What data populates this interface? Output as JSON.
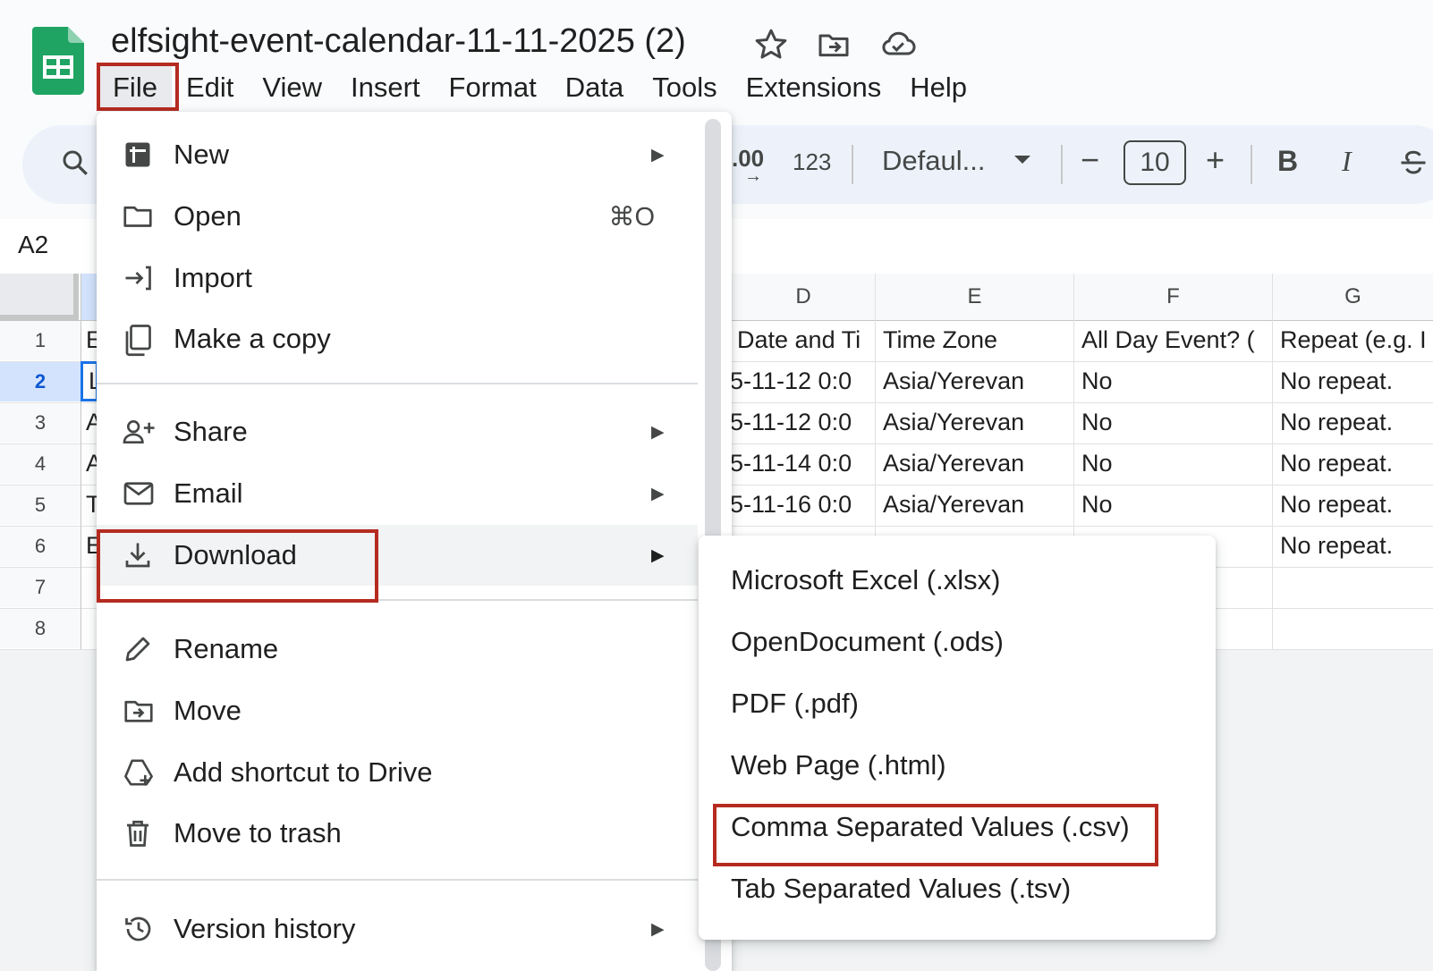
{
  "document": {
    "title": "elfsight-event-calendar-11-11-2025 (2)"
  },
  "header_icons": [
    "star-icon",
    "move-folder-icon",
    "cloud-saved-icon"
  ],
  "menubar": {
    "items": [
      "File",
      "Edit",
      "View",
      "Insert",
      "Format",
      "Data",
      "Tools",
      "Extensions",
      "Help"
    ]
  },
  "toolbar": {
    "decimal_label": ".00",
    "number_format_label": "123",
    "font_name": "Defaul...",
    "font_size": "10",
    "minus_label": "−",
    "plus_label": "+",
    "bold_label": "B",
    "italic_label": "I"
  },
  "name_box": "A2",
  "grid": {
    "column_headers": [
      "D",
      "E",
      "F",
      "G"
    ],
    "row_numbers": [
      "1",
      "2",
      "3",
      "4",
      "5",
      "6",
      "7",
      "8"
    ],
    "visible_col_a_chars": [
      "E",
      "L",
      "A",
      "A",
      "T",
      "E"
    ],
    "cells": {
      "D": [
        "Date and Ti",
        "5-11-12 0:0",
        "5-11-12 0:0",
        "5-11-14 0:0",
        "5-11-16 0:0"
      ],
      "E": [
        "Time Zone",
        "Asia/Yerevan",
        "Asia/Yerevan",
        "Asia/Yerevan",
        "Asia/Yerevan"
      ],
      "F": [
        "All Day Event? (",
        "No",
        "No",
        "No",
        "No"
      ],
      "G": [
        "Repeat (e.g. I",
        "No repeat.",
        "No repeat.",
        "No repeat.",
        "No repeat.",
        "No repeat."
      ]
    }
  },
  "file_menu": {
    "new": "New",
    "open": "Open",
    "open_shortcut": "⌘O",
    "import": "Import",
    "make_copy": "Make a copy",
    "share": "Share",
    "email": "Email",
    "download": "Download",
    "rename": "Rename",
    "move": "Move",
    "add_shortcut": "Add shortcut to Drive",
    "move_to_trash": "Move to trash",
    "version_history": "Version history"
  },
  "download_submenu": {
    "items": [
      "Microsoft Excel (.xlsx)",
      "OpenDocument (.ods)",
      "PDF (.pdf)",
      "Web Page (.html)",
      "Comma Separated Values (.csv)",
      "Tab Separated Values (.tsv)"
    ]
  },
  "colors": {
    "highlight_box": "#b52b20",
    "sheets_green": "#1fa463",
    "selected_row_header": "#d3e3fd",
    "active_menu_item": "#f1f3f4"
  }
}
